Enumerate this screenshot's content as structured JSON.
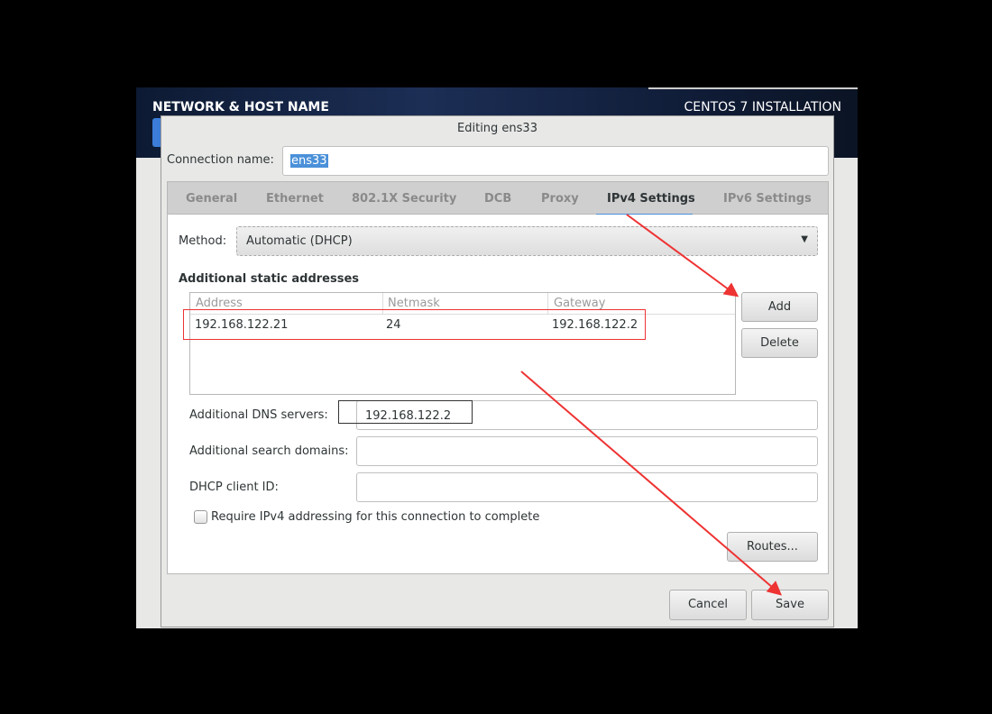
{
  "installer": {
    "section_title": "NETWORK & HOST NAME",
    "product_title": "CENTOS 7 INSTALLATION"
  },
  "dialog": {
    "title": "Editing ens33",
    "connection_name_label": "Connection name:",
    "connection_name_value": "ens33",
    "tabs": [
      {
        "label": "General"
      },
      {
        "label": "Ethernet"
      },
      {
        "label": "802.1X Security"
      },
      {
        "label": "DCB"
      },
      {
        "label": "Proxy"
      },
      {
        "label": "IPv4 Settings"
      },
      {
        "label": "IPv6 Settings"
      }
    ],
    "active_tab": "IPv4 Settings",
    "method_label": "Method:",
    "method_value": "Automatic (DHCP)",
    "static_heading": "Additional static addresses",
    "columns": [
      "Address",
      "Netmask",
      "Gateway"
    ],
    "rows": [
      {
        "address": "192.168.122.21",
        "netmask": "24",
        "gateway": "192.168.122.2"
      }
    ],
    "add_label": "Add",
    "delete_label": "Delete",
    "dns_label": "Additional DNS servers:",
    "dns_value": "192.168.122.2",
    "search_label": "Additional search domains:",
    "search_value": "",
    "dhcp_label": "DHCP client ID:",
    "dhcp_value": "",
    "require_label": "Require IPv4 addressing for this connection to complete",
    "require_checked": false,
    "routes_label": "Routes...",
    "cancel_label": "Cancel",
    "save_label": "Save"
  },
  "colors": {
    "accent": "#4a90d9",
    "annotation": "#e33333"
  }
}
